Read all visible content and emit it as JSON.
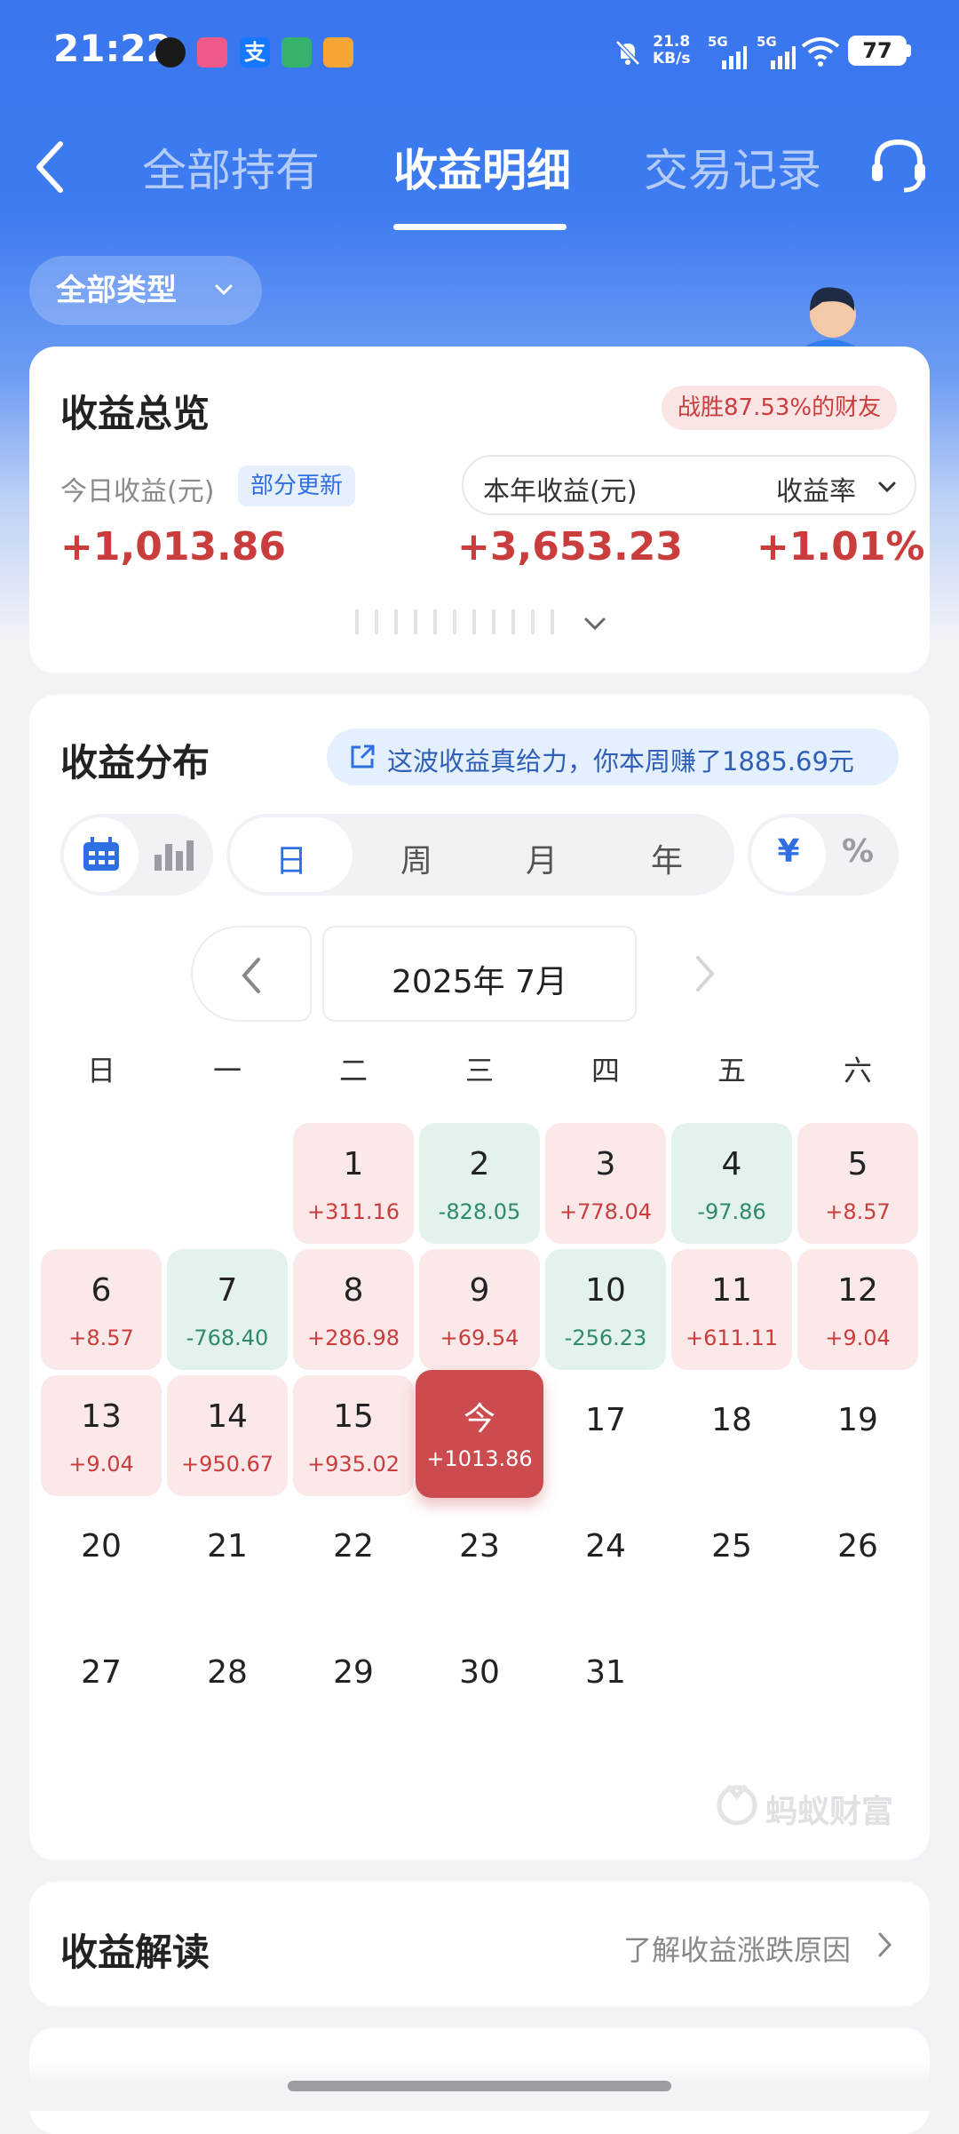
{
  "status_bar": {
    "time": "21:22",
    "net_speed": "21.8",
    "net_unit": "KB/s",
    "sim1": "5G",
    "sim2": "5G",
    "battery": "77"
  },
  "nav": {
    "tabs": [
      "全部持有",
      "收益明细",
      "交易记录"
    ],
    "active_tab": 1
  },
  "filter": {
    "label": "全部类型"
  },
  "overview": {
    "title": "收益总览",
    "badge": "战胜87.53%的财友",
    "today_label": "今日收益(元)",
    "partial_tag": "部分更新",
    "today_value": "+1,013.86",
    "year_label": "本年收益(元)",
    "rate_label": "收益率",
    "year_value": "+3,653.23",
    "rate_value": "+1.01%"
  },
  "distribution": {
    "title": "收益分布",
    "banner": "这波收益真给力，你本周赚了1885.69元",
    "periods": [
      "日",
      "周",
      "月",
      "年"
    ],
    "active_period": "日",
    "units": [
      "¥",
      "%"
    ],
    "active_unit": "¥",
    "month_label": "2025年 7月",
    "weekdays": [
      "日",
      "一",
      "二",
      "三",
      "四",
      "五",
      "六"
    ],
    "days": [
      {
        "day": "1",
        "value": "+311.16",
        "trend": "up"
      },
      {
        "day": "2",
        "value": "-828.05",
        "trend": "down"
      },
      {
        "day": "3",
        "value": "+778.04",
        "trend": "up"
      },
      {
        "day": "4",
        "value": "-97.86",
        "trend": "down"
      },
      {
        "day": "5",
        "value": "+8.57",
        "trend": "up"
      },
      {
        "day": "6",
        "value": "+8.57",
        "trend": "up"
      },
      {
        "day": "7",
        "value": "-768.40",
        "trend": "down"
      },
      {
        "day": "8",
        "value": "+286.98",
        "trend": "up"
      },
      {
        "day": "9",
        "value": "+69.54",
        "trend": "up"
      },
      {
        "day": "10",
        "value": "-256.23",
        "trend": "down"
      },
      {
        "day": "11",
        "value": "+611.11",
        "trend": "up"
      },
      {
        "day": "12",
        "value": "+9.04",
        "trend": "up"
      },
      {
        "day": "13",
        "value": "+9.04",
        "trend": "up"
      },
      {
        "day": "14",
        "value": "+950.67",
        "trend": "up"
      },
      {
        "day": "15",
        "value": "+935.02",
        "trend": "up"
      },
      {
        "day": "今",
        "value": "+1013.86",
        "trend": "today"
      },
      {
        "day": "17",
        "value": "",
        "trend": "none"
      },
      {
        "day": "18",
        "value": "",
        "trend": "none"
      },
      {
        "day": "19",
        "value": "",
        "trend": "none"
      },
      {
        "day": "20",
        "value": "",
        "trend": "none"
      },
      {
        "day": "21",
        "value": "",
        "trend": "none"
      },
      {
        "day": "22",
        "value": "",
        "trend": "none"
      },
      {
        "day": "23",
        "value": "",
        "trend": "none"
      },
      {
        "day": "24",
        "value": "",
        "trend": "none"
      },
      {
        "day": "25",
        "value": "",
        "trend": "none"
      },
      {
        "day": "26",
        "value": "",
        "trend": "none"
      },
      {
        "day": "27",
        "value": "",
        "trend": "none"
      },
      {
        "day": "28",
        "value": "",
        "trend": "none"
      },
      {
        "day": "29",
        "value": "",
        "trend": "none"
      },
      {
        "day": "30",
        "value": "",
        "trend": "none"
      },
      {
        "day": "31",
        "value": "",
        "trend": "none"
      }
    ],
    "watermark": "蚂蚁财富"
  },
  "interpret": {
    "title": "收益解读",
    "link": "了解收益涨跌原因"
  },
  "colors": {
    "header_blue": "#3a76ee",
    "gain_red": "#c93d3d",
    "loss_green": "#2f8a6b",
    "today_red": "#cc4b4f",
    "accent_blue": "#2f6fe4"
  }
}
